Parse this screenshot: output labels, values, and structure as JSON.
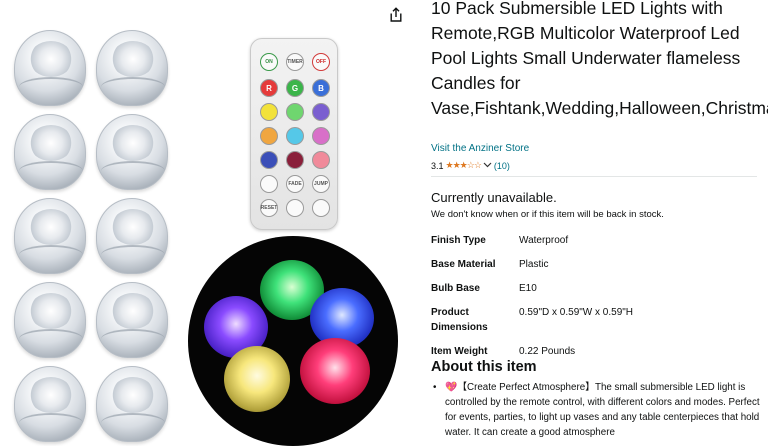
{
  "product": {
    "title": "10 Pack Submersible LED Lights with Remote,RGB Multicolor Waterproof Led Pool Lights Small Underwater flameless Candles for Vase,Fishtank,Wedding,Halloween,Christmas",
    "store_link": "Visit the Anziner Store",
    "rating_value": "3.1",
    "rating_stars": 3.1,
    "rating_count": "(10)",
    "availability": "Currently unavailable.",
    "availability_note": "We don't know when or if this item will be back in stock."
  },
  "specs": [
    {
      "key": "Finish Type",
      "value": "Waterproof"
    },
    {
      "key": "Base Material",
      "value": "Plastic"
    },
    {
      "key": "Bulb Base",
      "value": "E10"
    },
    {
      "key": "Product Dimensions",
      "value": "0.59\"D x 0.59\"W x 0.59\"H"
    },
    {
      "key": "Item Weight",
      "value": "0.22 Pounds"
    }
  ],
  "about": {
    "heading": "About this item",
    "bullets": [
      "💖【Create Perfect Atmosphere】The small submersible LED light is controlled by the remote control, with different colors and modes. Perfect for events, parties, to light up vases and any table centerpieces that hold water. It can create a good atmosphere"
    ]
  },
  "remote": {
    "top_labels": [
      "ON",
      "TIMER",
      "OFF"
    ],
    "rgb_labels": [
      "R",
      "G",
      "B"
    ],
    "bottom_labels": [
      "FADE",
      "JUMP"
    ],
    "reset_label": "RESET"
  },
  "icons": {
    "share": "share-icon",
    "chevron": "chevron-down-icon"
  },
  "colors": {
    "link": "#007185",
    "star": "#de7921",
    "text": "#0f1111"
  }
}
